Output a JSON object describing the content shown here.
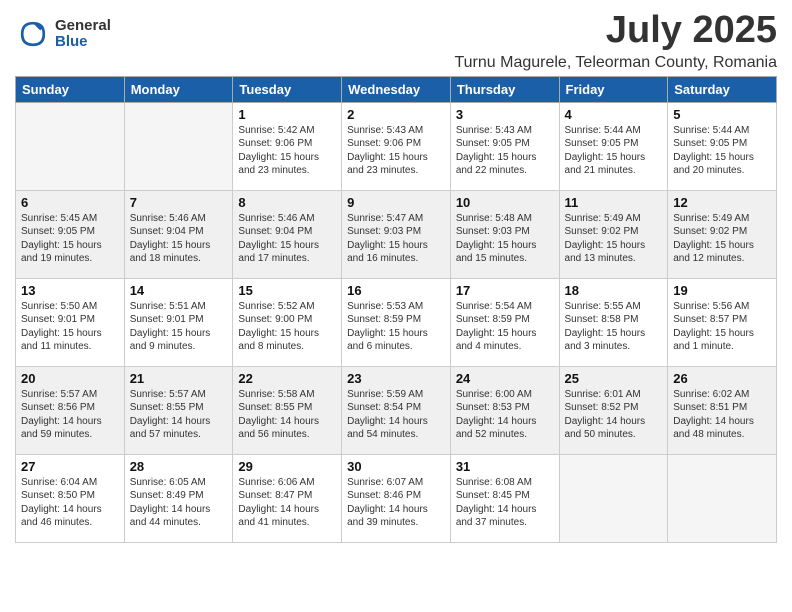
{
  "logo": {
    "general": "General",
    "blue": "Blue"
  },
  "title": {
    "month_year": "July 2025",
    "location": "Turnu Magurele, Teleorman County, Romania"
  },
  "days_of_week": [
    "Sunday",
    "Monday",
    "Tuesday",
    "Wednesday",
    "Thursday",
    "Friday",
    "Saturday"
  ],
  "weeks": [
    [
      {
        "day": "",
        "info": ""
      },
      {
        "day": "",
        "info": ""
      },
      {
        "day": "1",
        "info": "Sunrise: 5:42 AM\nSunset: 9:06 PM\nDaylight: 15 hours and 23 minutes."
      },
      {
        "day": "2",
        "info": "Sunrise: 5:43 AM\nSunset: 9:06 PM\nDaylight: 15 hours and 23 minutes."
      },
      {
        "day": "3",
        "info": "Sunrise: 5:43 AM\nSunset: 9:05 PM\nDaylight: 15 hours and 22 minutes."
      },
      {
        "day": "4",
        "info": "Sunrise: 5:44 AM\nSunset: 9:05 PM\nDaylight: 15 hours and 21 minutes."
      },
      {
        "day": "5",
        "info": "Sunrise: 5:44 AM\nSunset: 9:05 PM\nDaylight: 15 hours and 20 minutes."
      }
    ],
    [
      {
        "day": "6",
        "info": "Sunrise: 5:45 AM\nSunset: 9:05 PM\nDaylight: 15 hours and 19 minutes."
      },
      {
        "day": "7",
        "info": "Sunrise: 5:46 AM\nSunset: 9:04 PM\nDaylight: 15 hours and 18 minutes."
      },
      {
        "day": "8",
        "info": "Sunrise: 5:46 AM\nSunset: 9:04 PM\nDaylight: 15 hours and 17 minutes."
      },
      {
        "day": "9",
        "info": "Sunrise: 5:47 AM\nSunset: 9:03 PM\nDaylight: 15 hours and 16 minutes."
      },
      {
        "day": "10",
        "info": "Sunrise: 5:48 AM\nSunset: 9:03 PM\nDaylight: 15 hours and 15 minutes."
      },
      {
        "day": "11",
        "info": "Sunrise: 5:49 AM\nSunset: 9:02 PM\nDaylight: 15 hours and 13 minutes."
      },
      {
        "day": "12",
        "info": "Sunrise: 5:49 AM\nSunset: 9:02 PM\nDaylight: 15 hours and 12 minutes."
      }
    ],
    [
      {
        "day": "13",
        "info": "Sunrise: 5:50 AM\nSunset: 9:01 PM\nDaylight: 15 hours and 11 minutes."
      },
      {
        "day": "14",
        "info": "Sunrise: 5:51 AM\nSunset: 9:01 PM\nDaylight: 15 hours and 9 minutes."
      },
      {
        "day": "15",
        "info": "Sunrise: 5:52 AM\nSunset: 9:00 PM\nDaylight: 15 hours and 8 minutes."
      },
      {
        "day": "16",
        "info": "Sunrise: 5:53 AM\nSunset: 8:59 PM\nDaylight: 15 hours and 6 minutes."
      },
      {
        "day": "17",
        "info": "Sunrise: 5:54 AM\nSunset: 8:59 PM\nDaylight: 15 hours and 4 minutes."
      },
      {
        "day": "18",
        "info": "Sunrise: 5:55 AM\nSunset: 8:58 PM\nDaylight: 15 hours and 3 minutes."
      },
      {
        "day": "19",
        "info": "Sunrise: 5:56 AM\nSunset: 8:57 PM\nDaylight: 15 hours and 1 minute."
      }
    ],
    [
      {
        "day": "20",
        "info": "Sunrise: 5:57 AM\nSunset: 8:56 PM\nDaylight: 14 hours and 59 minutes."
      },
      {
        "day": "21",
        "info": "Sunrise: 5:57 AM\nSunset: 8:55 PM\nDaylight: 14 hours and 57 minutes."
      },
      {
        "day": "22",
        "info": "Sunrise: 5:58 AM\nSunset: 8:55 PM\nDaylight: 14 hours and 56 minutes."
      },
      {
        "day": "23",
        "info": "Sunrise: 5:59 AM\nSunset: 8:54 PM\nDaylight: 14 hours and 54 minutes."
      },
      {
        "day": "24",
        "info": "Sunrise: 6:00 AM\nSunset: 8:53 PM\nDaylight: 14 hours and 52 minutes."
      },
      {
        "day": "25",
        "info": "Sunrise: 6:01 AM\nSunset: 8:52 PM\nDaylight: 14 hours and 50 minutes."
      },
      {
        "day": "26",
        "info": "Sunrise: 6:02 AM\nSunset: 8:51 PM\nDaylight: 14 hours and 48 minutes."
      }
    ],
    [
      {
        "day": "27",
        "info": "Sunrise: 6:04 AM\nSunset: 8:50 PM\nDaylight: 14 hours and 46 minutes."
      },
      {
        "day": "28",
        "info": "Sunrise: 6:05 AM\nSunset: 8:49 PM\nDaylight: 14 hours and 44 minutes."
      },
      {
        "day": "29",
        "info": "Sunrise: 6:06 AM\nSunset: 8:47 PM\nDaylight: 14 hours and 41 minutes."
      },
      {
        "day": "30",
        "info": "Sunrise: 6:07 AM\nSunset: 8:46 PM\nDaylight: 14 hours and 39 minutes."
      },
      {
        "day": "31",
        "info": "Sunrise: 6:08 AM\nSunset: 8:45 PM\nDaylight: 14 hours and 37 minutes."
      },
      {
        "day": "",
        "info": ""
      },
      {
        "day": "",
        "info": ""
      }
    ]
  ]
}
